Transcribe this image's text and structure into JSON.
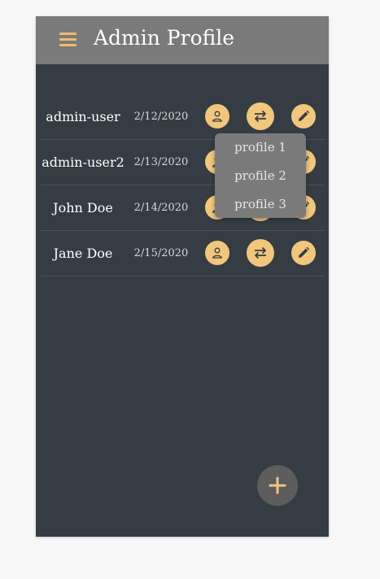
{
  "app": {
    "title": "Admin Profile"
  },
  "colors": {
    "accent": "#f0c77d",
    "header_bg": "#7a7a7a",
    "body_bg": "#353c44"
  },
  "users": [
    {
      "name": "admin-user",
      "date": "2/12/2020"
    },
    {
      "name": "admin-user2",
      "date": "2/13/2020"
    },
    {
      "name": "John Doe",
      "date": "2/14/2020"
    },
    {
      "name": "Jane Doe",
      "date": "2/15/2020"
    }
  ],
  "row_actions": {
    "profile_icon": "person-icon",
    "switch_icon": "swap-arrows-icon",
    "edit_icon": "pencil-icon"
  },
  "dropdown": {
    "items": [
      "profile 1",
      "profile 2",
      "profile 3"
    ]
  },
  "fab": {
    "icon": "plus-icon"
  }
}
